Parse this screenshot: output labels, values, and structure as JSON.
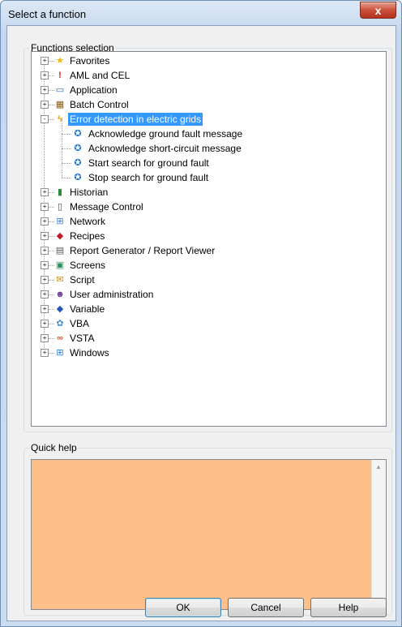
{
  "window": {
    "title": "Select a function",
    "close_label": "x"
  },
  "functions_group": {
    "label": "Functions selection"
  },
  "tree": [
    {
      "label": "Favorites",
      "icon": "star-icon",
      "expander": "+"
    },
    {
      "label": "AML and CEL",
      "icon": "alarm-icon",
      "expander": "+"
    },
    {
      "label": "Application",
      "icon": "application-window-icon",
      "expander": "+"
    },
    {
      "label": "Batch Control",
      "icon": "batch-network-icon",
      "expander": "+"
    },
    {
      "label": "Error detection in electric grids",
      "icon": "lightning-icon",
      "expander": "-",
      "selected": true
    },
    {
      "label": "Acknowledge ground fault message",
      "icon": "function-gear-icon",
      "child": true
    },
    {
      "label": "Acknowledge short-circuit message",
      "icon": "function-gear-icon",
      "child": true
    },
    {
      "label": "Start search for ground fault",
      "icon": "function-gear-icon",
      "child": true
    },
    {
      "label": "Stop search for ground fault",
      "icon": "function-gear-icon",
      "child": true
    },
    {
      "label": "Historian",
      "icon": "historian-icon",
      "expander": "+"
    },
    {
      "label": "Message Control",
      "icon": "phone-icon",
      "expander": "+"
    },
    {
      "label": "Network",
      "icon": "network-icon",
      "expander": "+"
    },
    {
      "label": "Recipes",
      "icon": "recipe-icon",
      "expander": "+"
    },
    {
      "label": "Report Generator / Report Viewer",
      "icon": "report-icon",
      "expander": "+"
    },
    {
      "label": "Screens",
      "icon": "screens-icon",
      "expander": "+"
    },
    {
      "label": "Script",
      "icon": "script-icon",
      "expander": "+"
    },
    {
      "label": "User administration",
      "icon": "users-icon",
      "expander": "+"
    },
    {
      "label": "Variable",
      "icon": "variable-icon",
      "expander": "+"
    },
    {
      "label": "VBA",
      "icon": "vba-icon",
      "expander": "+"
    },
    {
      "label": "VSTA",
      "icon": "vsta-icon",
      "expander": "+"
    },
    {
      "label": "Windows",
      "icon": "windows-logo-icon",
      "expander": "+"
    }
  ],
  "quick_help": {
    "label": "Quick help",
    "background": "#ffbf88"
  },
  "buttons": {
    "ok": "OK",
    "cancel": "Cancel",
    "help": "Help"
  },
  "colors": {
    "selection": "#3399ff",
    "close": "#c9503a"
  }
}
